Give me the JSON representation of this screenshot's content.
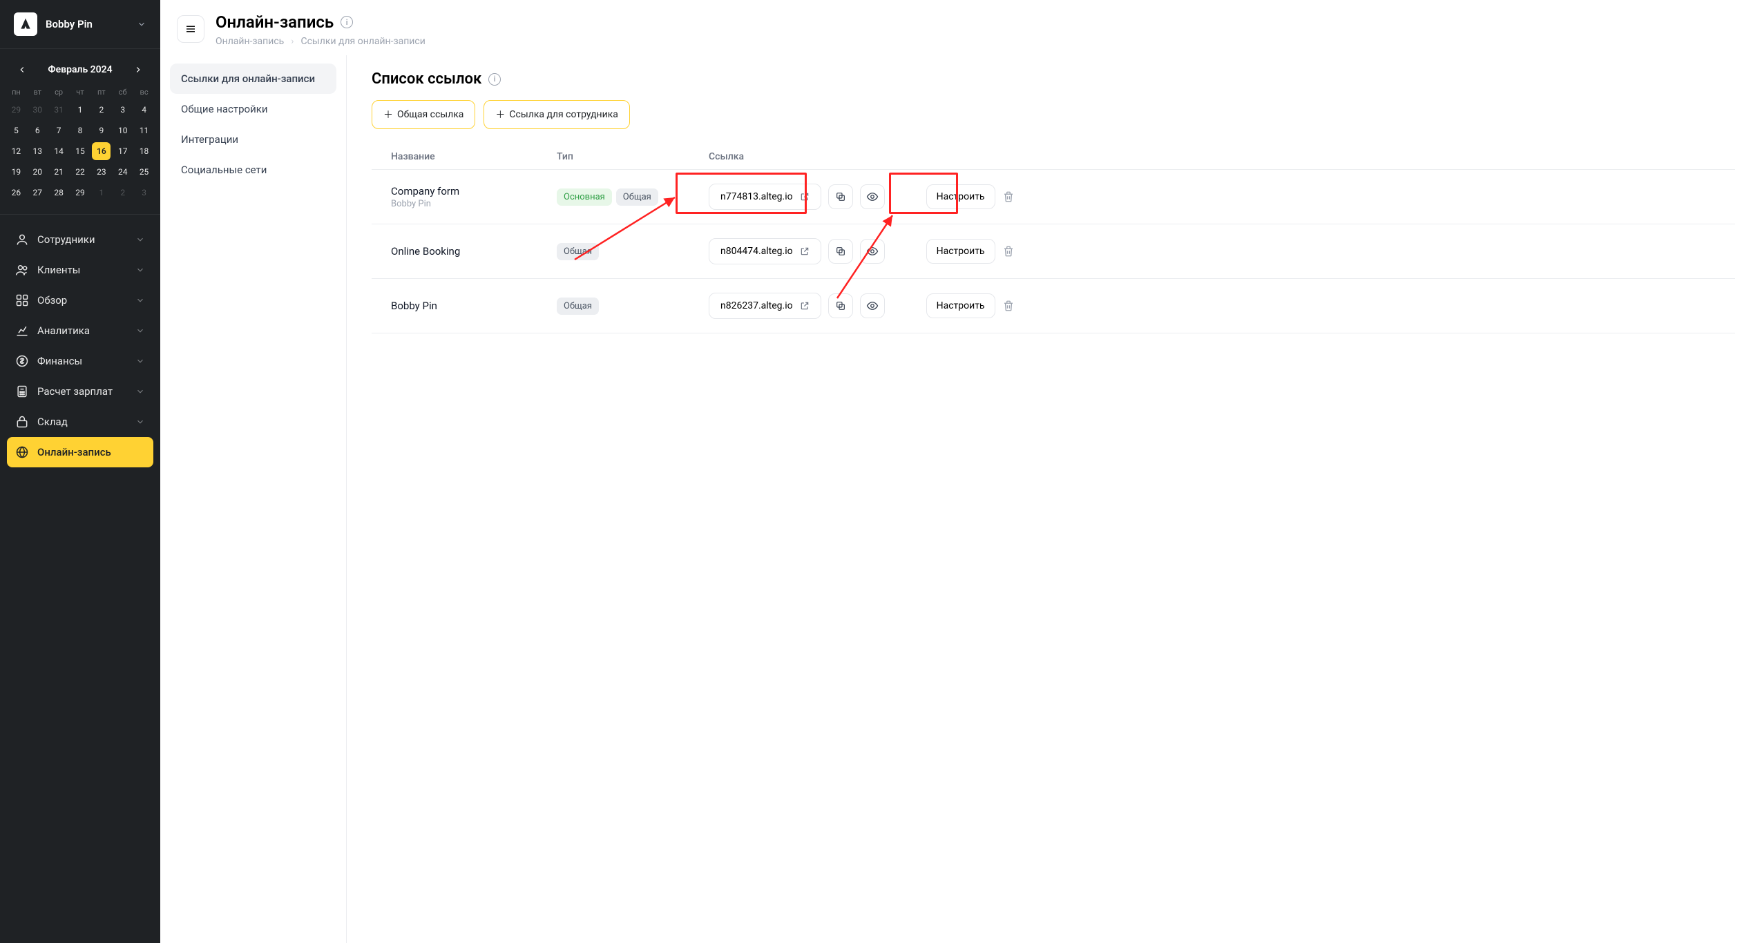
{
  "brand": {
    "name": "Bobby Pin"
  },
  "calendar": {
    "title": "Февраль 2024",
    "dow": [
      "пн",
      "вт",
      "ср",
      "чт",
      "пт",
      "сб",
      "вс"
    ],
    "days": [
      {
        "n": "29",
        "dim": true
      },
      {
        "n": "30",
        "dim": true
      },
      {
        "n": "31",
        "dim": true
      },
      {
        "n": "1"
      },
      {
        "n": "2"
      },
      {
        "n": "3"
      },
      {
        "n": "4"
      },
      {
        "n": "5"
      },
      {
        "n": "6"
      },
      {
        "n": "7"
      },
      {
        "n": "8"
      },
      {
        "n": "9"
      },
      {
        "n": "10"
      },
      {
        "n": "11"
      },
      {
        "n": "12"
      },
      {
        "n": "13"
      },
      {
        "n": "14"
      },
      {
        "n": "15"
      },
      {
        "n": "16",
        "selected": true
      },
      {
        "n": "17"
      },
      {
        "n": "18"
      },
      {
        "n": "19"
      },
      {
        "n": "20"
      },
      {
        "n": "21"
      },
      {
        "n": "22"
      },
      {
        "n": "23"
      },
      {
        "n": "24"
      },
      {
        "n": "25"
      },
      {
        "n": "26"
      },
      {
        "n": "27"
      },
      {
        "n": "28"
      },
      {
        "n": "29"
      },
      {
        "n": "1",
        "dim": true
      },
      {
        "n": "2",
        "dim": true
      },
      {
        "n": "3",
        "dim": true
      }
    ]
  },
  "nav": {
    "items": [
      {
        "label": "Сотрудники",
        "icon": "users"
      },
      {
        "label": "Клиенты",
        "icon": "people"
      },
      {
        "label": "Обзор",
        "icon": "grid"
      },
      {
        "label": "Аналитика",
        "icon": "chart"
      },
      {
        "label": "Финансы",
        "icon": "dollar"
      },
      {
        "label": "Расчет зарплат",
        "icon": "calc"
      },
      {
        "label": "Склад",
        "icon": "lock"
      },
      {
        "label": "Онлайн-запись",
        "icon": "globe",
        "active": true
      }
    ]
  },
  "header": {
    "title": "Онлайн-запись",
    "breadcrumb1": "Онлайн-запись",
    "breadcrumb2": "Ссылки для онлайн-записи"
  },
  "subnav": {
    "items": [
      {
        "label": "Ссылки для онлайн-записи",
        "active": true
      },
      {
        "label": "Общие настройки"
      },
      {
        "label": "Интеграции"
      },
      {
        "label": "Социальные сети"
      }
    ]
  },
  "panel": {
    "title": "Список ссылок",
    "action_shared": "Общая ссылка",
    "action_staff": "Ссылка для сотрудника",
    "columns": {
      "name": "Название",
      "type": "Тип",
      "link": "Ссылка"
    },
    "settings_label": "Настроить",
    "rows": [
      {
        "name": "Company form",
        "sub": "Bobby Pin",
        "badges": [
          {
            "t": "Основная",
            "c": "green"
          },
          {
            "t": "Общая",
            "c": "gray"
          }
        ],
        "url": "n774813.alteg.io"
      },
      {
        "name": "Online Booking",
        "badges": [
          {
            "t": "Общая",
            "c": "gray"
          }
        ],
        "url": "n804474.alteg.io"
      },
      {
        "name": "Bobby Pin",
        "badges": [
          {
            "t": "Общая",
            "c": "gray"
          }
        ],
        "url": "n826237.alteg.io"
      }
    ]
  }
}
